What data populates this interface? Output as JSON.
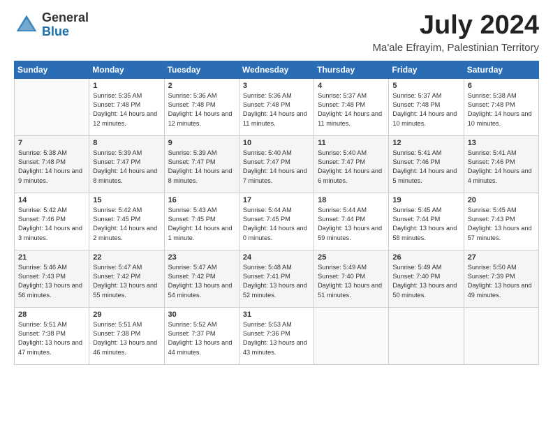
{
  "header": {
    "logo_general": "General",
    "logo_blue": "Blue",
    "month": "July 2024",
    "location": "Ma'ale Efrayim, Palestinian Territory"
  },
  "weekdays": [
    "Sunday",
    "Monday",
    "Tuesday",
    "Wednesday",
    "Thursday",
    "Friday",
    "Saturday"
  ],
  "weeks": [
    [
      {
        "day": "",
        "sunrise": "",
        "sunset": "",
        "daylight": ""
      },
      {
        "day": "1",
        "sunrise": "Sunrise: 5:35 AM",
        "sunset": "Sunset: 7:48 PM",
        "daylight": "Daylight: 14 hours and 12 minutes."
      },
      {
        "day": "2",
        "sunrise": "Sunrise: 5:36 AM",
        "sunset": "Sunset: 7:48 PM",
        "daylight": "Daylight: 14 hours and 12 minutes."
      },
      {
        "day": "3",
        "sunrise": "Sunrise: 5:36 AM",
        "sunset": "Sunset: 7:48 PM",
        "daylight": "Daylight: 14 hours and 11 minutes."
      },
      {
        "day": "4",
        "sunrise": "Sunrise: 5:37 AM",
        "sunset": "Sunset: 7:48 PM",
        "daylight": "Daylight: 14 hours and 11 minutes."
      },
      {
        "day": "5",
        "sunrise": "Sunrise: 5:37 AM",
        "sunset": "Sunset: 7:48 PM",
        "daylight": "Daylight: 14 hours and 10 minutes."
      },
      {
        "day": "6",
        "sunrise": "Sunrise: 5:38 AM",
        "sunset": "Sunset: 7:48 PM",
        "daylight": "Daylight: 14 hours and 10 minutes."
      }
    ],
    [
      {
        "day": "7",
        "sunrise": "Sunrise: 5:38 AM",
        "sunset": "Sunset: 7:48 PM",
        "daylight": "Daylight: 14 hours and 9 minutes."
      },
      {
        "day": "8",
        "sunrise": "Sunrise: 5:39 AM",
        "sunset": "Sunset: 7:47 PM",
        "daylight": "Daylight: 14 hours and 8 minutes."
      },
      {
        "day": "9",
        "sunrise": "Sunrise: 5:39 AM",
        "sunset": "Sunset: 7:47 PM",
        "daylight": "Daylight: 14 hours and 8 minutes."
      },
      {
        "day": "10",
        "sunrise": "Sunrise: 5:40 AM",
        "sunset": "Sunset: 7:47 PM",
        "daylight": "Daylight: 14 hours and 7 minutes."
      },
      {
        "day": "11",
        "sunrise": "Sunrise: 5:40 AM",
        "sunset": "Sunset: 7:47 PM",
        "daylight": "Daylight: 14 hours and 6 minutes."
      },
      {
        "day": "12",
        "sunrise": "Sunrise: 5:41 AM",
        "sunset": "Sunset: 7:46 PM",
        "daylight": "Daylight: 14 hours and 5 minutes."
      },
      {
        "day": "13",
        "sunrise": "Sunrise: 5:41 AM",
        "sunset": "Sunset: 7:46 PM",
        "daylight": "Daylight: 14 hours and 4 minutes."
      }
    ],
    [
      {
        "day": "14",
        "sunrise": "Sunrise: 5:42 AM",
        "sunset": "Sunset: 7:46 PM",
        "daylight": "Daylight: 14 hours and 3 minutes."
      },
      {
        "day": "15",
        "sunrise": "Sunrise: 5:42 AM",
        "sunset": "Sunset: 7:45 PM",
        "daylight": "Daylight: 14 hours and 2 minutes."
      },
      {
        "day": "16",
        "sunrise": "Sunrise: 5:43 AM",
        "sunset": "Sunset: 7:45 PM",
        "daylight": "Daylight: 14 hours and 1 minute."
      },
      {
        "day": "17",
        "sunrise": "Sunrise: 5:44 AM",
        "sunset": "Sunset: 7:45 PM",
        "daylight": "Daylight: 14 hours and 0 minutes."
      },
      {
        "day": "18",
        "sunrise": "Sunrise: 5:44 AM",
        "sunset": "Sunset: 7:44 PM",
        "daylight": "Daylight: 13 hours and 59 minutes."
      },
      {
        "day": "19",
        "sunrise": "Sunrise: 5:45 AM",
        "sunset": "Sunset: 7:44 PM",
        "daylight": "Daylight: 13 hours and 58 minutes."
      },
      {
        "day": "20",
        "sunrise": "Sunrise: 5:45 AM",
        "sunset": "Sunset: 7:43 PM",
        "daylight": "Daylight: 13 hours and 57 minutes."
      }
    ],
    [
      {
        "day": "21",
        "sunrise": "Sunrise: 5:46 AM",
        "sunset": "Sunset: 7:43 PM",
        "daylight": "Daylight: 13 hours and 56 minutes."
      },
      {
        "day": "22",
        "sunrise": "Sunrise: 5:47 AM",
        "sunset": "Sunset: 7:42 PM",
        "daylight": "Daylight: 13 hours and 55 minutes."
      },
      {
        "day": "23",
        "sunrise": "Sunrise: 5:47 AM",
        "sunset": "Sunset: 7:42 PM",
        "daylight": "Daylight: 13 hours and 54 minutes."
      },
      {
        "day": "24",
        "sunrise": "Sunrise: 5:48 AM",
        "sunset": "Sunset: 7:41 PM",
        "daylight": "Daylight: 13 hours and 52 minutes."
      },
      {
        "day": "25",
        "sunrise": "Sunrise: 5:49 AM",
        "sunset": "Sunset: 7:40 PM",
        "daylight": "Daylight: 13 hours and 51 minutes."
      },
      {
        "day": "26",
        "sunrise": "Sunrise: 5:49 AM",
        "sunset": "Sunset: 7:40 PM",
        "daylight": "Daylight: 13 hours and 50 minutes."
      },
      {
        "day": "27",
        "sunrise": "Sunrise: 5:50 AM",
        "sunset": "Sunset: 7:39 PM",
        "daylight": "Daylight: 13 hours and 49 minutes."
      }
    ],
    [
      {
        "day": "28",
        "sunrise": "Sunrise: 5:51 AM",
        "sunset": "Sunset: 7:38 PM",
        "daylight": "Daylight: 13 hours and 47 minutes."
      },
      {
        "day": "29",
        "sunrise": "Sunrise: 5:51 AM",
        "sunset": "Sunset: 7:38 PM",
        "daylight": "Daylight: 13 hours and 46 minutes."
      },
      {
        "day": "30",
        "sunrise": "Sunrise: 5:52 AM",
        "sunset": "Sunset: 7:37 PM",
        "daylight": "Daylight: 13 hours and 44 minutes."
      },
      {
        "day": "31",
        "sunrise": "Sunrise: 5:53 AM",
        "sunset": "Sunset: 7:36 PM",
        "daylight": "Daylight: 13 hours and 43 minutes."
      },
      {
        "day": "",
        "sunrise": "",
        "sunset": "",
        "daylight": ""
      },
      {
        "day": "",
        "sunrise": "",
        "sunset": "",
        "daylight": ""
      },
      {
        "day": "",
        "sunrise": "",
        "sunset": "",
        "daylight": ""
      }
    ]
  ]
}
